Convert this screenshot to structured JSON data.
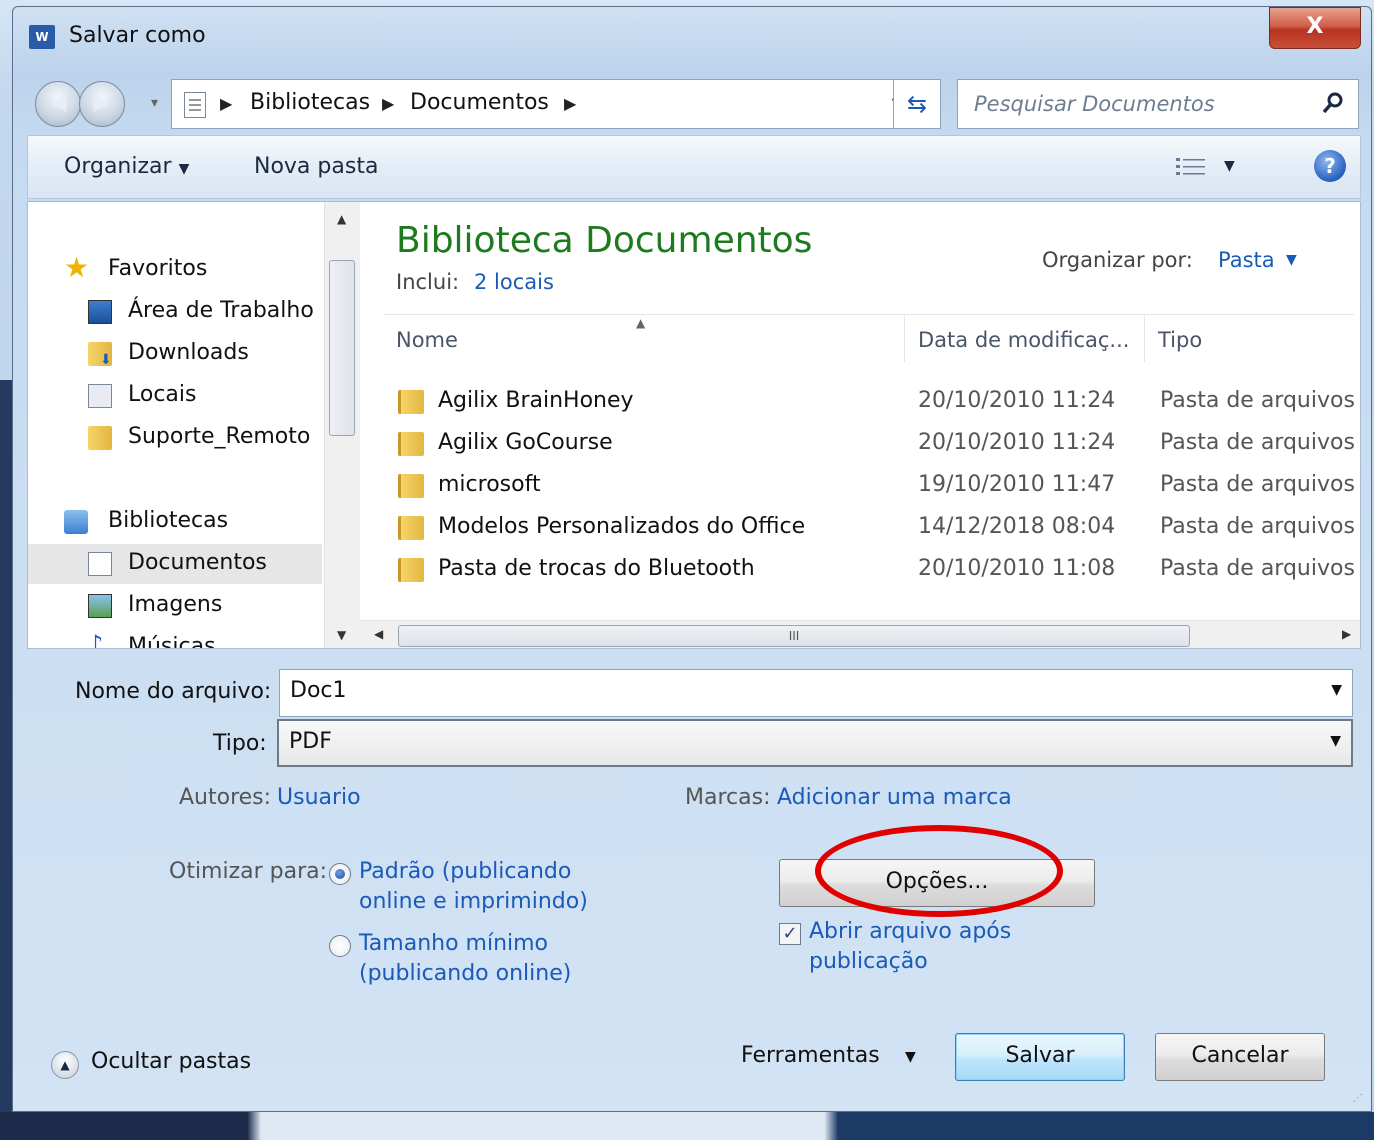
{
  "window": {
    "title": "Salvar como",
    "app_icon": "W",
    "close_label": "X"
  },
  "address": {
    "crumbs": [
      "Bibliotecas",
      "Documentos"
    ],
    "search_placeholder": "Pesquisar Documentos"
  },
  "toolbar": {
    "organize": "Organizar",
    "new_folder": "Nova pasta",
    "help": "?"
  },
  "nav": {
    "favorites": "Favoritos",
    "favorites_items": [
      "Área de Trabalho",
      "Downloads",
      "Locais",
      "Suporte_Remoto"
    ],
    "libraries": "Bibliotecas",
    "libraries_items": [
      "Documentos",
      "Imagens",
      "Músicas"
    ]
  },
  "library": {
    "title": "Biblioteca Documentos",
    "includes_label": "Inclui:",
    "includes_link": "2 locais",
    "arrange_label": "Organizar por:",
    "arrange_value": "Pasta"
  },
  "columns": {
    "name": "Nome",
    "date": "Data de modificaç...",
    "type": "Tipo"
  },
  "files": [
    {
      "name": "Agilix BrainHoney",
      "date": "20/10/2010 11:24",
      "type": "Pasta de arquivos"
    },
    {
      "name": "Agilix GoCourse",
      "date": "20/10/2010 11:24",
      "type": "Pasta de arquivos"
    },
    {
      "name": "microsoft",
      "date": "19/10/2010 11:47",
      "type": "Pasta de arquivos"
    },
    {
      "name": "Modelos Personalizados do Office",
      "date": "14/12/2018 08:04",
      "type": "Pasta de arquivos"
    },
    {
      "name": "Pasta de trocas do Bluetooth",
      "date": "20/10/2010 11:08",
      "type": "Pasta de arquivos"
    }
  ],
  "hscroll_grip": "III",
  "form": {
    "filename_label": "Nome do arquivo:",
    "filename_value": "Doc1",
    "type_label": "Tipo:",
    "type_value": "PDF",
    "authors_label": "Autores:",
    "authors_value": "Usuario",
    "tags_label": "Marcas:",
    "tags_value": "Adicionar uma marca",
    "optimize_label": "Otimizar para:",
    "optimize_options": [
      "Padrão (publicando online e imprimindo)",
      "Tamanho mínimo (publicando online)"
    ],
    "optimize_options_lines": [
      [
        "Padrão (publicando",
        "online e imprimindo)"
      ],
      [
        "Tamanho mínimo",
        "(publicando online)"
      ]
    ],
    "options_button": "Opções...",
    "open_after_lines": [
      "Abrir arquivo após",
      "publicação"
    ],
    "open_after_checked": true,
    "selected_optimize": 0
  },
  "footer": {
    "hide_folders": "Ocultar pastas",
    "tools": "Ferramentas",
    "save": "Salvar",
    "cancel": "Cancelar"
  },
  "colors": {
    "accent_link": "#1a5ab8",
    "library_title": "#1e7a1e",
    "annotation": "#e10000"
  }
}
